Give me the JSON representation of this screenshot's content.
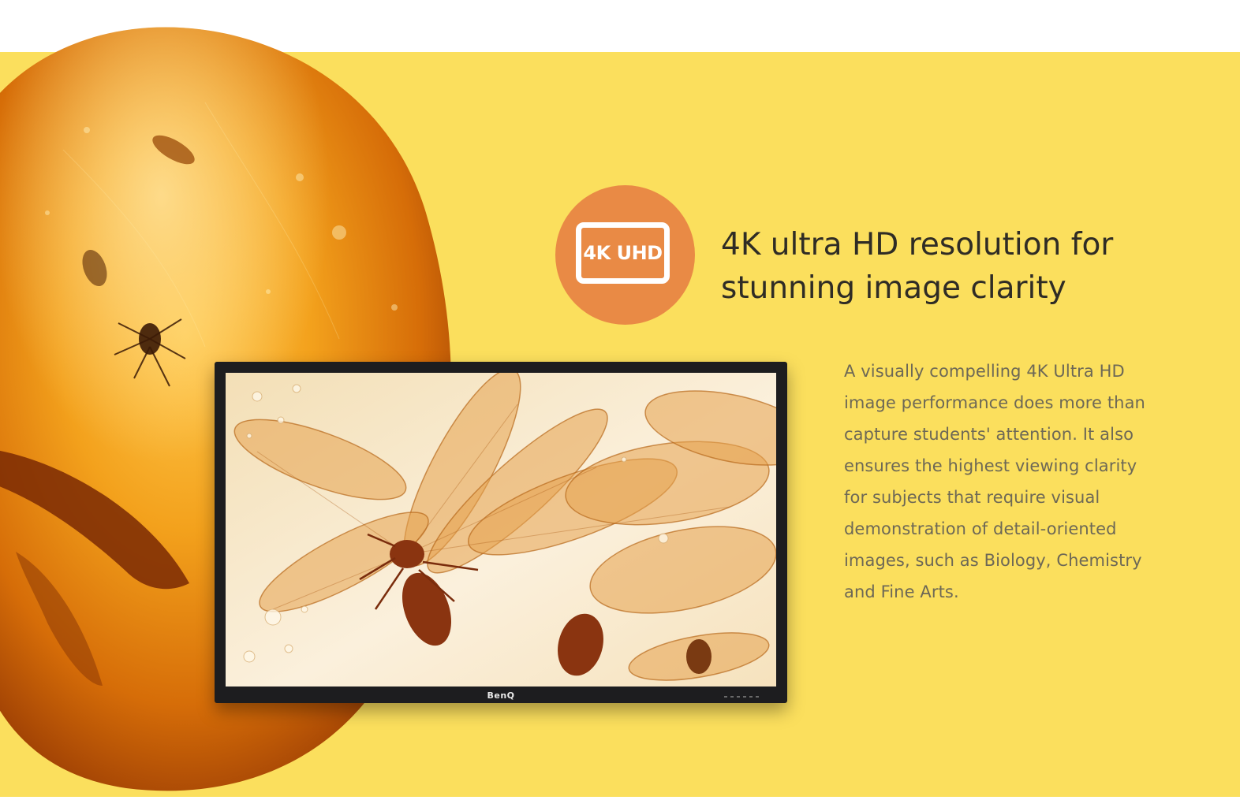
{
  "badge": {
    "label": "4K UHD",
    "color": "#e98a45"
  },
  "headline": {
    "lines": [
      "4K ultra HD resolution for",
      "stunning image clarity"
    ]
  },
  "description": {
    "lines": [
      "A visually compelling 4K Ultra HD",
      "image performance does more than",
      "capture students' attention. It also",
      "ensures the highest viewing clarity",
      "for subjects that require visual",
      "demonstration of detail-oriented",
      "images, such as Biology, Chemistry",
      "and Fine Arts."
    ]
  },
  "monitor": {
    "brand_logo": "BenQ"
  },
  "colors": {
    "background_yellow": "#fbdf5d",
    "badge_orange": "#e98a45",
    "headline_text": "#2f2c25",
    "body_text": "#6d6856"
  }
}
